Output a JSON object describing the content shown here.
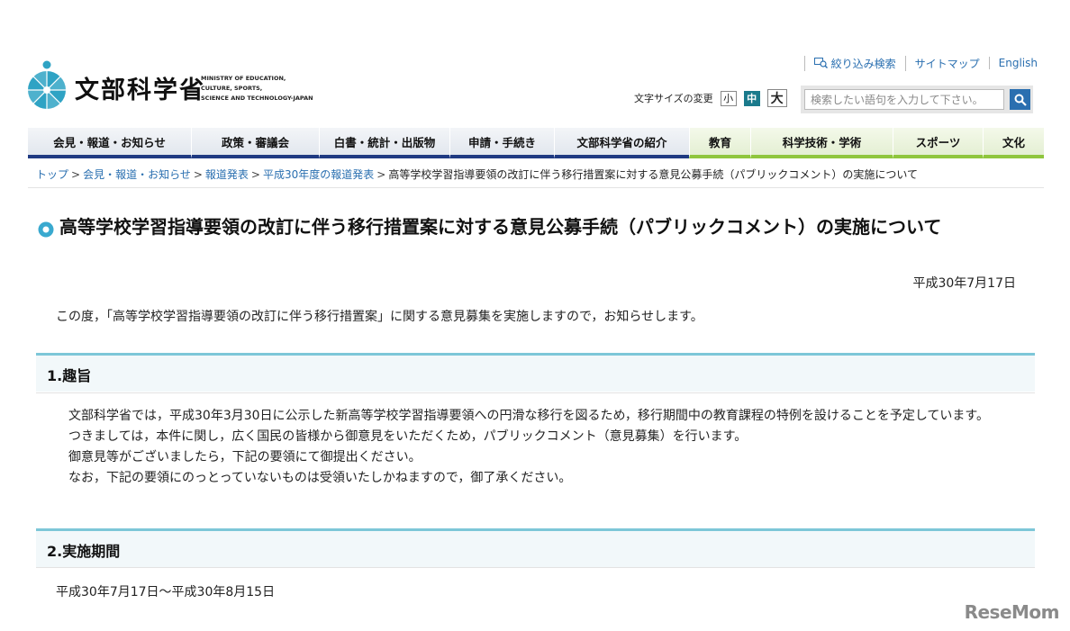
{
  "header": {
    "logo_jp": "文部科学省",
    "logo_en_lines": [
      "MINISTRY OF EDUCATION,",
      "CULTURE, SPORTS,",
      "SCIENCE AND TECHNOLOGY-JAPAN"
    ],
    "util_links": {
      "filter_search": "絞り込み検索",
      "sitemap": "サイトマップ",
      "english": "English"
    },
    "font_size": {
      "label": "文字サイズの変更",
      "small": "小",
      "medium": "中",
      "large": "大",
      "selected": "中"
    },
    "search": {
      "placeholder": "検索したい語句を入力して下さい。"
    }
  },
  "nav": {
    "items": [
      "会見・報道・お知らせ",
      "政策・審議会",
      "白書・統計・出版物",
      "申請・手続き",
      "文部科学省の紹介",
      "教育",
      "科学技術・学術",
      "スポーツ",
      "文化"
    ],
    "colors": {
      "blue_underline": "#1f3a82",
      "green_underline": "#8fc63d"
    }
  },
  "breadcrumb": {
    "links": [
      "トップ",
      "会見・報道・お知らせ",
      "報道発表",
      "平成30年度の報道発表"
    ],
    "current": "高等学校学習指導要領の改訂に伴う移行措置案に対する意見公募手続（パブリックコメント）の実施について",
    "separator": ">"
  },
  "article": {
    "title": "高等学校学習指導要領の改訂に伴う移行措置案に対する意見公募手続（パブリックコメント）の実施について",
    "date": "平成30年7月17日",
    "intro": "この度，「高等学校学習指導要領の改訂に伴う移行措置案」に関する意見募集を実施しますので，お知らせします。",
    "section1": {
      "heading": "1.趣旨",
      "paragraphs": [
        "文部科学省では，平成30年3月30日に公示した新高等学校学習指導要領への円滑な移行を図るため，移行期間中の教育課程の特例を設けることを予定しています。",
        "つきましては，本件に関し，広く国民の皆様から御意見をいただくため，パブリックコメント（意見募集）を行います。",
        "御意見等がございましたら，下記の要領にて御提出ください。",
        "なお，下記の要領にのっとっていないものは受領いたしかねますので，御了承ください。"
      ]
    },
    "section2": {
      "heading": "2.実施期間",
      "period": "平成30年7月17日〜平成30年8月15日"
    },
    "accent_color": "#7dc7d8"
  },
  "watermark": "ReseMom"
}
